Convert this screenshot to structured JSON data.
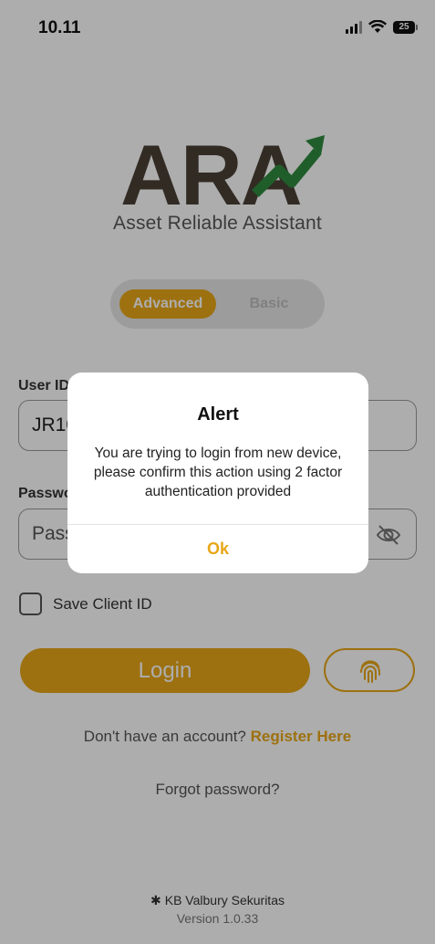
{
  "status_bar": {
    "time": "10.11",
    "battery": "25"
  },
  "logo": {
    "wordmark": "ARA",
    "subtitle": "Asset Reliable Assistant"
  },
  "mode_toggle": {
    "options": [
      "Advanced",
      "Basic"
    ],
    "selected": "Advanced"
  },
  "form": {
    "user_id": {
      "label": "User ID",
      "value": "JR10"
    },
    "password": {
      "label": "Password",
      "placeholder": "Password"
    },
    "save_client_id": {
      "label": "Save Client ID",
      "checked": false
    }
  },
  "buttons": {
    "login": "Login",
    "fingerprint_icon": "fingerprint-icon"
  },
  "register": {
    "prompt": "Don't have an account?",
    "link": "Register Here"
  },
  "forgot_password": "Forgot password?",
  "footer": {
    "brand": "KB Valbury Sekuritas",
    "version": "Version 1.0.33"
  },
  "alert": {
    "title": "Alert",
    "message": "You are trying to login from new device, please confirm this action using 2 factor authentication provided",
    "button": "Ok"
  },
  "colors": {
    "accent": "#e8a718",
    "logo_dark": "#4a4036",
    "logo_green": "#2e8b3e",
    "overlay": "rgba(0,0,0,0.32)"
  }
}
